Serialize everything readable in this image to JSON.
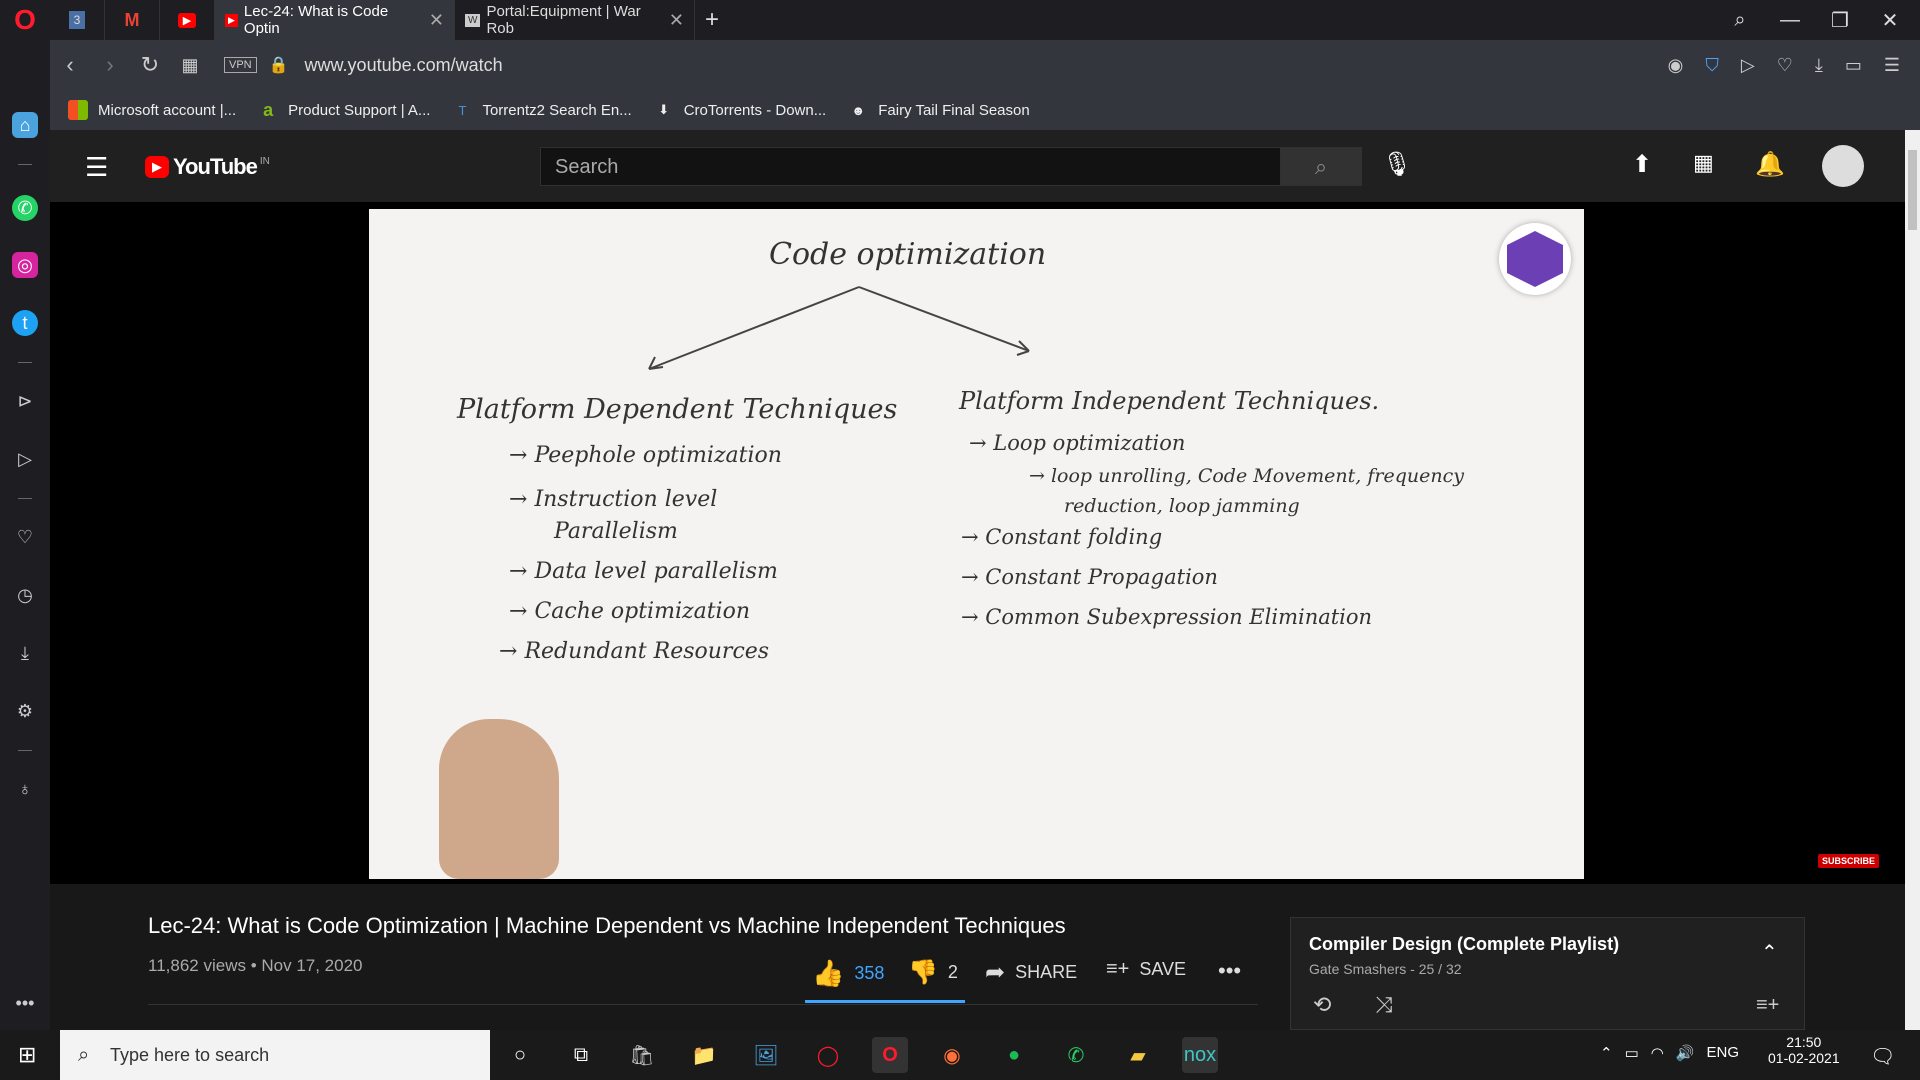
{
  "browser": {
    "tabs": [
      {
        "label": "",
        "icon": "opera-mail-icon",
        "badge": "3"
      },
      {
        "label": "",
        "icon": "gmail-icon"
      },
      {
        "label": "",
        "icon": "youtube-icon"
      },
      {
        "label": "Lec-24: What is Code Optin",
        "icon": "youtube-icon",
        "active": true
      },
      {
        "label": "Portal:Equipment | War Rob",
        "icon": "wiki-icon"
      }
    ],
    "url": "www.youtube.com/watch",
    "vpn": "VPN",
    "bookmarks": [
      {
        "label": "Microsoft account |...",
        "icon": "microsoft-icon"
      },
      {
        "label": "Product Support | A...",
        "icon": "acer-icon"
      },
      {
        "label": "Torrentz2 Search En...",
        "icon": "torrentz-icon"
      },
      {
        "label": "CroTorrents - Down...",
        "icon": "download-icon"
      },
      {
        "label": "Fairy Tail Final Season",
        "icon": "anime-icon"
      }
    ]
  },
  "youtube": {
    "logo": "YouTube",
    "country": "IN",
    "search_placeholder": "Search",
    "video": {
      "title": "Lec-24: What is Code Optimization | Machine Dependent vs Machine Independent Techniques",
      "views": "11,862 views • Nov 17, 2020",
      "likes": "358",
      "dislikes": "2",
      "share": "SHARE",
      "save": "SAVE",
      "subscribe": "SUBSCRIBE"
    },
    "board": {
      "heading": "Code optimization",
      "left_title": "Platform Dependent Techniques",
      "left_items": [
        "Peephole optimization",
        "Instruction level",
        "Parallelism",
        "Data level parallelism",
        "Cache optimization",
        "Redundant Resources"
      ],
      "right_title": "Platform Independent Techniques.",
      "right_items": [
        "Loop optimization",
        "loop unrolling, Code Movement, frequency",
        "reduction, loop jamming",
        "Constant folding",
        "Constant Propagation",
        "Common Subexpression Elimination"
      ]
    },
    "playlist": {
      "title": "Compiler Design (Complete Playlist)",
      "meta": "Gate Smashers - 25 / 32"
    }
  },
  "taskbar": {
    "search_placeholder": "Type here to search",
    "lang": "ENG",
    "time": "21:50",
    "date": "01-02-2021"
  }
}
